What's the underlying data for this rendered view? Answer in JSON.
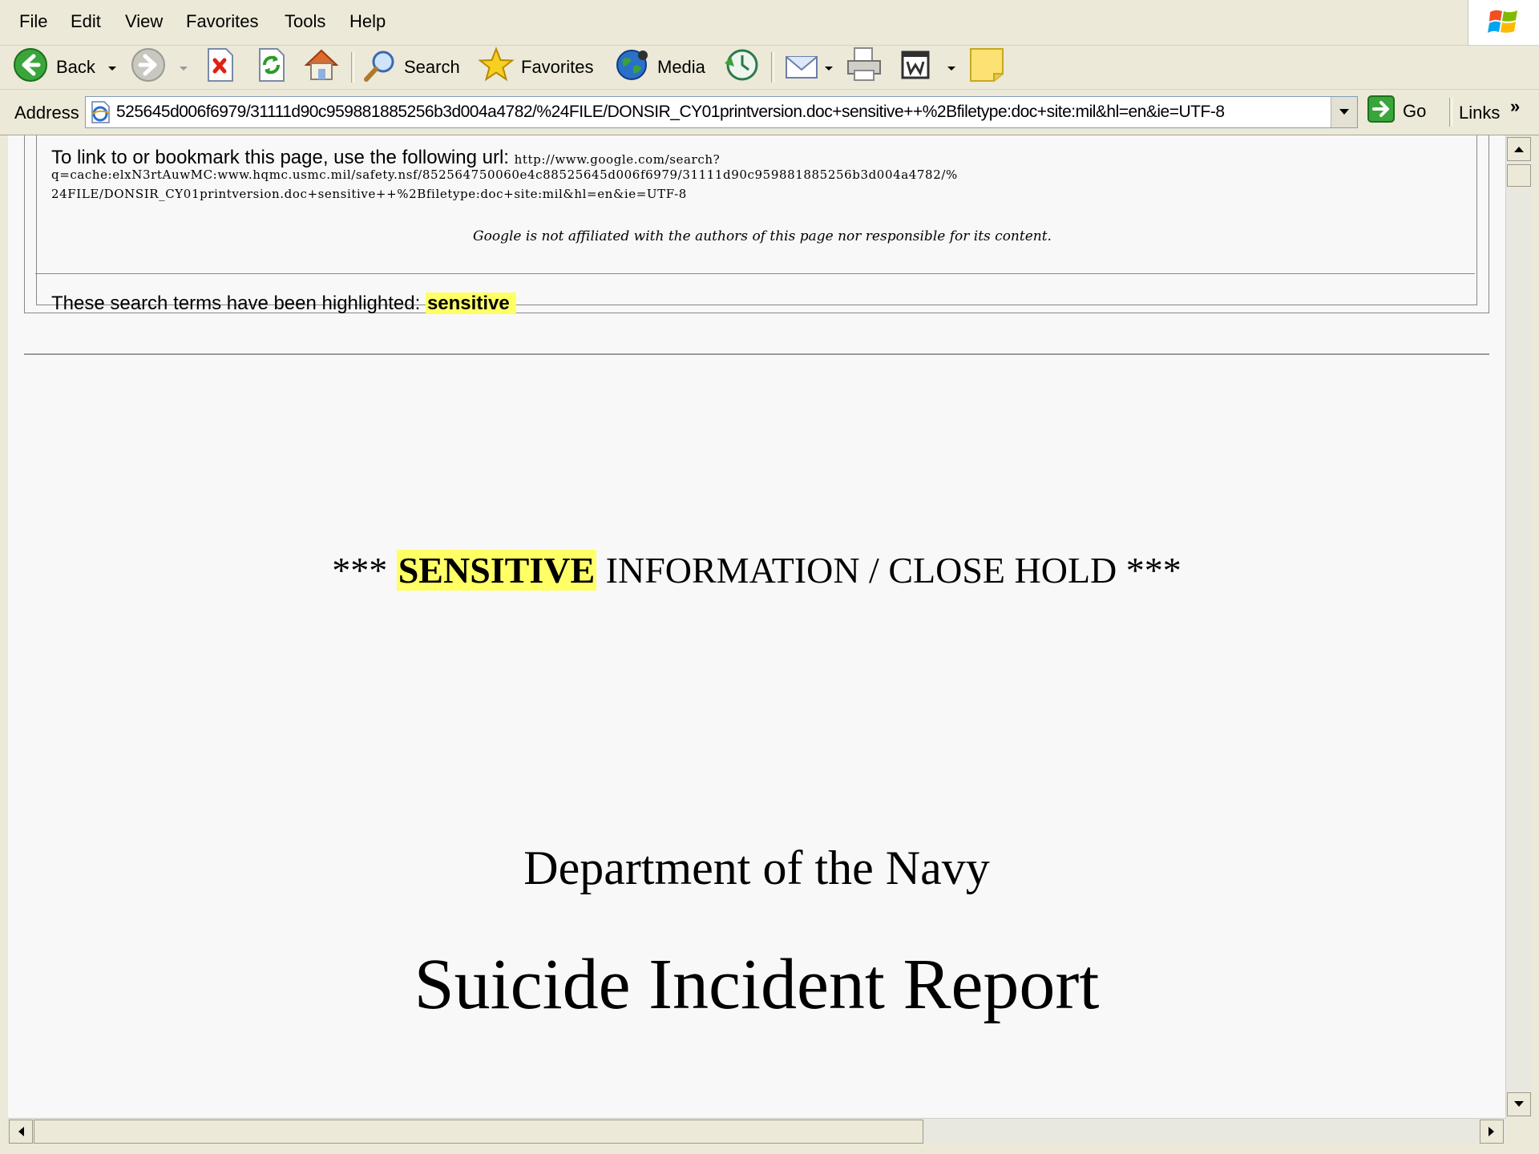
{
  "menu": {
    "items": [
      "File",
      "Edit",
      "View",
      "Favorites",
      "Tools",
      "Help"
    ]
  },
  "toolbar": {
    "back_label": "Back",
    "search_label": "Search",
    "favorites_label": "Favorites",
    "media_label": "Media"
  },
  "address": {
    "label": "Address",
    "value": "525645d006f6979/31111d90c959881885256b3d004a4782/%24FILE/DONSIR_CY01printversion.doc+sensitive++%2Bfiletype:doc+site:mil&hl=en&ie=UTF-8",
    "go_label": "Go",
    "links_label": "Links",
    "links_chevron": "»"
  },
  "cache_header": {
    "link_intro": "To link to or bookmark this page, use the following url:",
    "url_part1": "http://www.google.com/search?",
    "url_line1": "q=cache:elxN3rtAuwMC:www.hqmc.usmc.mil/safety.nsf/852564750060e4c88525645d006f6979/31111d90c959881885256b3d004a4782/%",
    "url_line2": "24FILE/DONSIR_CY01printversion.doc+sensitive++%2Bfiletype:doc+site:mil&hl=en&ie=UTF-8",
    "disclaimer": "Google is not affiliated with the authors of this page nor responsible for its content.",
    "terms_intro": "These search terms have been highlighted:",
    "highlighted_term": "sensitive"
  },
  "document": {
    "banner_prefix": "*** ",
    "banner_highlight": "SENSITIVE",
    "banner_suffix": " INFORMATION / CLOSE HOLD ***",
    "department": "Department of the Navy",
    "title": "Suicide Incident Report"
  },
  "colors": {
    "highlight": "#ffff66",
    "chrome": "#ece9d8",
    "page_bg": "#f8f8f8"
  },
  "icons": [
    "back-icon",
    "forward-icon",
    "stop-icon",
    "refresh-icon",
    "home-icon",
    "search-icon",
    "favorites-star-icon",
    "media-icon",
    "history-icon",
    "mail-icon",
    "print-icon",
    "edit-word-icon",
    "notes-icon",
    "ie-page-icon",
    "go-arrow-icon",
    "windows-logo-icon"
  ]
}
